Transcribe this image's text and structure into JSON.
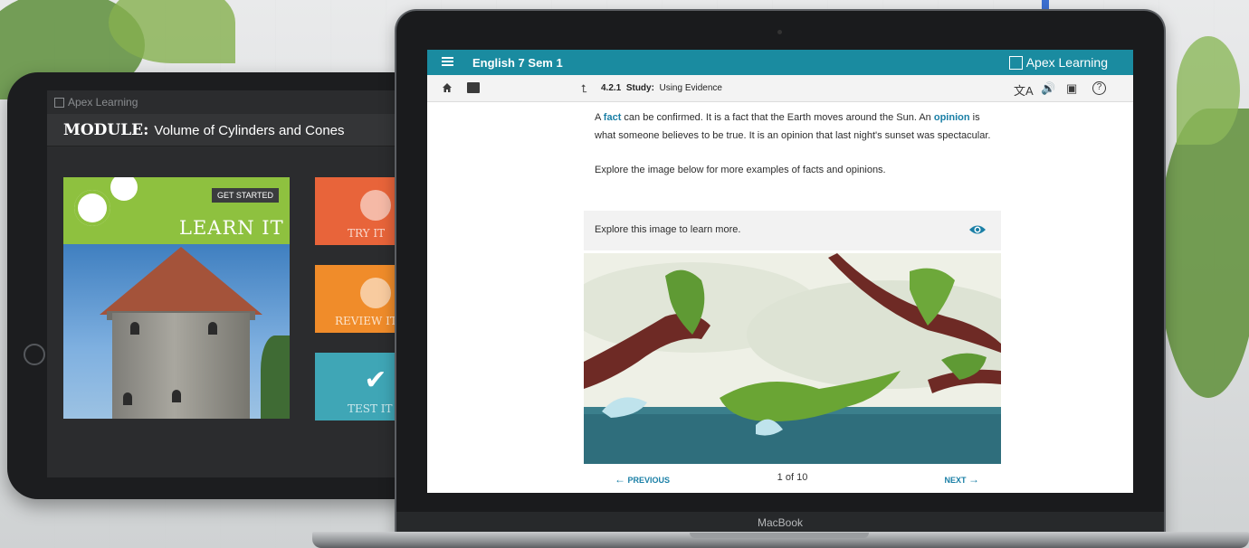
{
  "tablet": {
    "brand": "Apex Learning",
    "module_label": "MODULE:",
    "module_title": "Volume of Cylinders and Cones",
    "get_started": "GET STARTED",
    "learn_it": "LEARN IT",
    "try_it": "TRY IT",
    "review_it": "REVIEW IT",
    "test_it": "TEST IT"
  },
  "app": {
    "course_title": "English 7 Sem 1",
    "brand": "Apex Learning",
    "lesson_number": "4.2.1",
    "lesson_type": "Study:",
    "lesson_title": "Using Evidence"
  },
  "content": {
    "p1_a": "A",
    "p1_fact": "fact",
    "p1_b": "can be confirmed. It is a fact that the Earth moves around the Sun. An",
    "p1_opinion": "opinion",
    "p1_c": "is what someone believes to be true. It is an opinion that last night's sunset was spectacular.",
    "p2": "Explore the image below for more examples of facts and opinions.",
    "explore_prompt": "Explore this image to learn more."
  },
  "pager": {
    "previous": "PREVIOUS",
    "count": "1 of 10",
    "next": "NEXT"
  },
  "device": {
    "label": "MacBook"
  },
  "colors": {
    "app_bar": "#1a8ba0",
    "link": "#1a7fa6",
    "learn_green": "#8ec13f",
    "try_orange": "#e8643a",
    "review_orange": "#f08c2a",
    "test_teal": "#3fa6b6"
  },
  "icons": [
    "menu-icon",
    "home-icon",
    "briefcase-icon",
    "up-arrow-icon",
    "translate-icon",
    "audio-icon",
    "print-icon",
    "help-icon",
    "eye-icon",
    "arrow-left-icon",
    "arrow-right-icon",
    "gear-icon",
    "target-icon",
    "rewind-icon",
    "checkmark-icon"
  ]
}
